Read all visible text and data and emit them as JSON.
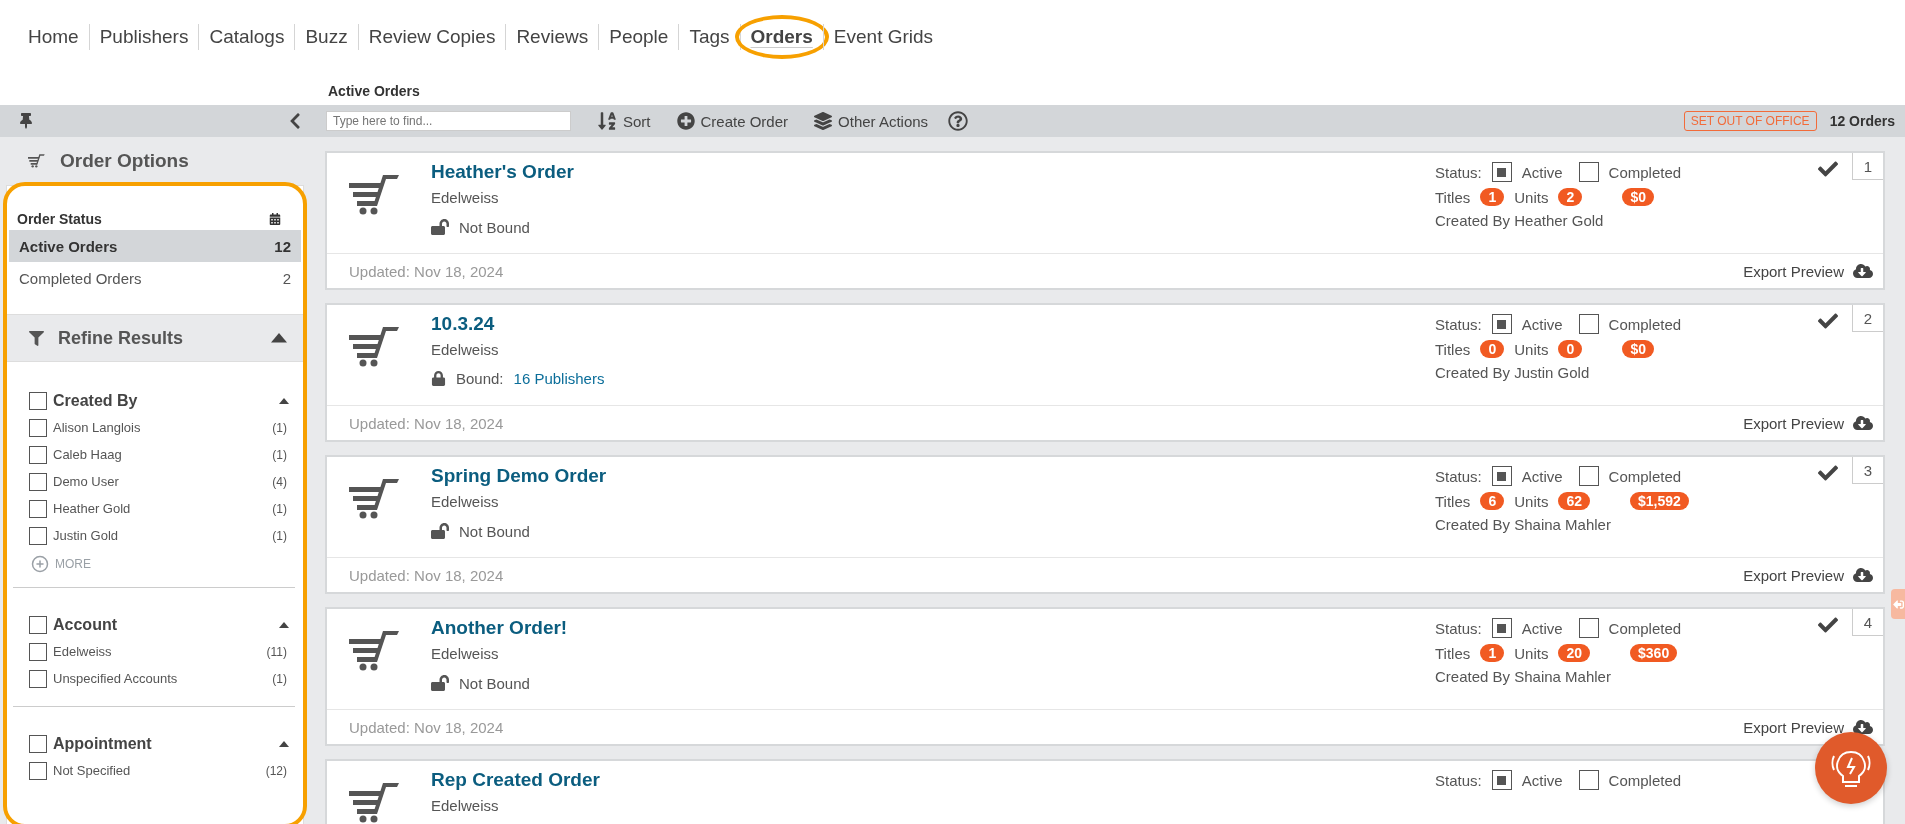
{
  "nav": [
    {
      "label": "Home",
      "selected": false,
      "highlighted": false
    },
    {
      "label": "Publishers",
      "selected": false,
      "highlighted": false
    },
    {
      "label": "Catalogs",
      "selected": false,
      "highlighted": false
    },
    {
      "label": "Buzz",
      "selected": false,
      "highlighted": false
    },
    {
      "label": "Review Copies",
      "selected": false,
      "highlighted": false
    },
    {
      "label": "Reviews",
      "selected": false,
      "highlighted": false
    },
    {
      "label": "People",
      "selected": false,
      "highlighted": false
    },
    {
      "label": "Tags",
      "selected": false,
      "highlighted": false
    },
    {
      "label": "Orders",
      "selected": true,
      "highlighted": true
    },
    {
      "label": "Event Grids",
      "selected": false,
      "highlighted": false
    }
  ],
  "page_title": "Active Orders",
  "toolbar": {
    "search": {
      "placeholder": "Type here to find..."
    },
    "sort": "Sort",
    "create": "Create Order",
    "other": "Other Actions",
    "out_of_office": "SET OUT OF OFFICE",
    "count": "12 Orders"
  },
  "sidebar": {
    "title": "Order Options",
    "highlighted": true,
    "status_title": "Order Status",
    "status_items": [
      {
        "label": "Active Orders",
        "count": "12",
        "selected": true
      },
      {
        "label": "Completed Orders",
        "count": "2",
        "selected": false
      }
    ],
    "refine_title": "Refine Results",
    "expanded": true,
    "groups": [
      {
        "title": "Created By",
        "checked": false,
        "more": "MORE",
        "items": [
          {
            "label": "Alison Langlois",
            "count": "(1)",
            "checked": false
          },
          {
            "label": "Caleb Haag",
            "count": "(1)",
            "checked": false
          },
          {
            "label": "Demo User",
            "count": "(4)",
            "checked": false
          },
          {
            "label": "Heather Gold",
            "count": "(1)",
            "checked": false
          },
          {
            "label": "Justin Gold",
            "count": "(1)",
            "checked": false
          }
        ]
      },
      {
        "title": "Account",
        "checked": false,
        "items": [
          {
            "label": "Edelweiss",
            "count": "(11)",
            "checked": false
          },
          {
            "label": "Unspecified Accounts",
            "count": "(1)",
            "checked": false
          }
        ]
      },
      {
        "title": "Appointment",
        "checked": false,
        "items": [
          {
            "label": "Not Specified",
            "count": "(12)",
            "checked": false
          }
        ]
      }
    ]
  },
  "orders": [
    {
      "title": "Heather's Order",
      "account": "Edelweiss",
      "bound": false,
      "bound_label": "Not Bound",
      "status_label": "Status:",
      "statuses": [
        {
          "label": "Active",
          "checked": true
        },
        {
          "label": "Completed",
          "checked": false
        }
      ],
      "titles_label": "Titles",
      "titles": "1",
      "units_label": "Units",
      "units": "2",
      "total": "$0",
      "created_by": "Created By Heather Gold",
      "number": "1",
      "updated": "Updated: Nov 18, 2024",
      "export": "Export Preview"
    },
    {
      "title": "10.3.24",
      "account": "Edelweiss",
      "bound": true,
      "bound_label": "Bound:",
      "publishers": "16 Publishers",
      "status_label": "Status:",
      "statuses": [
        {
          "label": "Active",
          "checked": true
        },
        {
          "label": "Completed",
          "checked": false
        }
      ],
      "titles_label": "Titles",
      "titles": "0",
      "units_label": "Units",
      "units": "0",
      "total": "$0",
      "created_by": "Created By Justin Gold",
      "number": "2",
      "updated": "Updated: Nov 18, 2024",
      "export": "Export Preview"
    },
    {
      "title": "Spring Demo Order",
      "account": "Edelweiss",
      "bound": false,
      "bound_label": "Not Bound",
      "status_label": "Status:",
      "statuses": [
        {
          "label": "Active",
          "checked": true
        },
        {
          "label": "Completed",
          "checked": false
        }
      ],
      "titles_label": "Titles",
      "titles": "6",
      "units_label": "Units",
      "units": "62",
      "total": "$1,592",
      "created_by": "Created By Shaina Mahler",
      "number": "3",
      "updated": "Updated: Nov 18, 2024",
      "export": "Export Preview"
    },
    {
      "title": "Another Order!",
      "account": "Edelweiss",
      "bound": false,
      "bound_label": "Not Bound",
      "status_label": "Status:",
      "statuses": [
        {
          "label": "Active",
          "checked": true
        },
        {
          "label": "Completed",
          "checked": false
        }
      ],
      "titles_label": "Titles",
      "titles": "1",
      "units_label": "Units",
      "units": "20",
      "total": "$360",
      "created_by": "Created By Shaina Mahler",
      "number": "4",
      "updated": "Updated: Nov 18, 2024",
      "export": "Export Preview"
    },
    {
      "title": "Rep Created Order",
      "account": "Edelweiss",
      "status_label": "Status:",
      "statuses": [
        {
          "label": "Active",
          "checked": true
        },
        {
          "label": "Completed",
          "checked": false
        }
      ]
    }
  ]
}
